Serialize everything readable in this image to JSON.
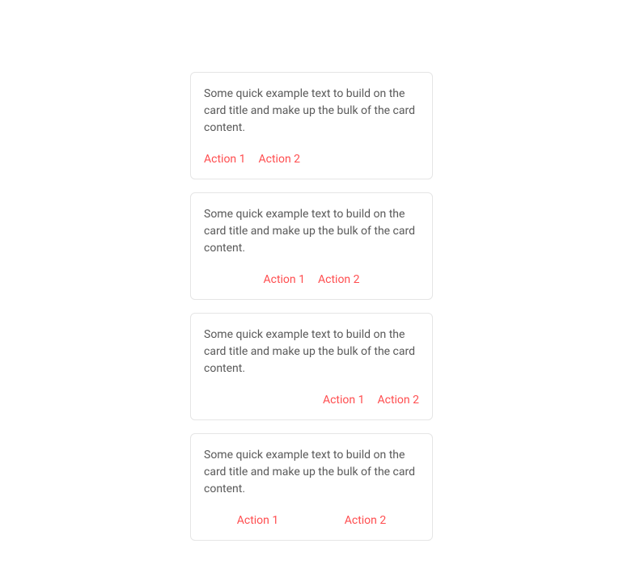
{
  "cards": [
    {
      "text": "Some quick example text to build on the card title and make up the bulk of the card content.",
      "actions": [
        "Action 1",
        "Action 2"
      ]
    },
    {
      "text": "Some quick example text to build on the card title and make up the bulk of the card content.",
      "actions": [
        "Action 1",
        "Action 2"
      ]
    },
    {
      "text": "Some quick example text to build on the card title and make up the bulk of the card content.",
      "actions": [
        "Action 1",
        "Action 2"
      ]
    },
    {
      "text": "Some quick example text to build on the card title and make up the bulk of the card content.",
      "actions": [
        "Action 1",
        "Action 2"
      ]
    }
  ]
}
